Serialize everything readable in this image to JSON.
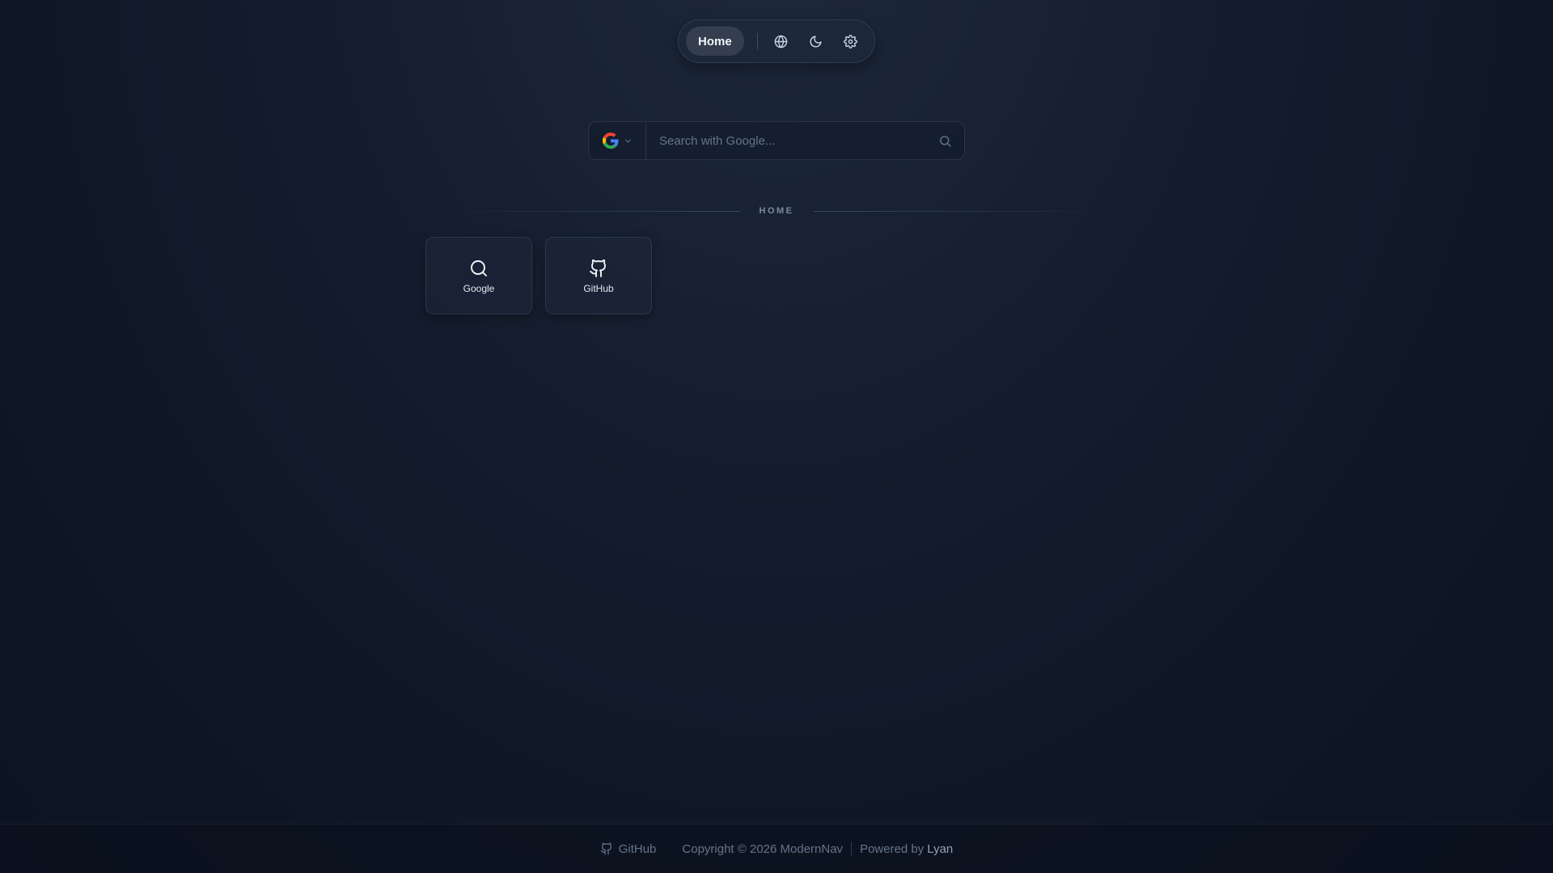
{
  "nav": {
    "home_label": "Home",
    "icons": [
      "globe-icon",
      "moon-icon",
      "gear-icon"
    ]
  },
  "search": {
    "engine_icon": "google-g-icon",
    "placeholder": "Search with Google...",
    "value": ""
  },
  "section": {
    "title": "HOME"
  },
  "cards": [
    {
      "label": "Google",
      "icon": "search-icon"
    },
    {
      "label": "GitHub",
      "icon": "github-icon"
    }
  ],
  "footer": {
    "github_label": "GitHub",
    "copyright": "Copyright © 2026 ModernNav",
    "powered_by": "Powered by",
    "author": "Lyan"
  },
  "colors": {
    "background": "#131c2c",
    "accent_text": "#e2e8f0",
    "muted_text": "#64748b",
    "google_blue": "#4285F4",
    "google_red": "#EA4335",
    "google_yellow": "#FBBC05",
    "google_green": "#34A853"
  }
}
